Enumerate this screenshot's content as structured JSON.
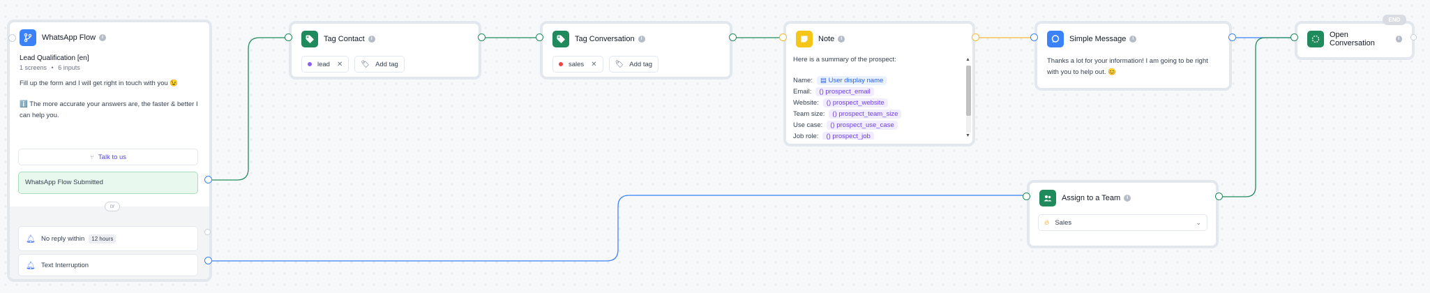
{
  "colors": {
    "green": "#1f8a5b",
    "blue": "#3b82f6",
    "yellow": "#f5c518",
    "submitted_bg": "#e9f8ef",
    "variable_purple": "#6d3fdf"
  },
  "whatsapp_flow": {
    "icon": "flow-branch-icon",
    "title": "WhatsApp Flow",
    "flow_name": "Lead Qualification [en]",
    "screens": "1 screens",
    "separator": "•",
    "inputs": "6 inputs",
    "text_line1": "Fill up the form and I will get right in touch with you 😉",
    "text_line2": "ℹ️ The more accurate your answers are, the faster & better I can help you.",
    "button_label": "Talk to us",
    "submitted_label": "WhatsApp Flow Submitted",
    "or_label": "or",
    "no_reply_label": "No reply within",
    "no_reply_value": "12 hours",
    "text_interruption_label": "Text Interruption"
  },
  "tag_contact": {
    "icon": "tag-icon",
    "title": "Tag Contact",
    "tag": "lead",
    "tag_color": "#8b5cf6",
    "add_label": "Add tag"
  },
  "tag_conversation": {
    "icon": "tag-icon",
    "title": "Tag Conversation",
    "tag": "sales",
    "tag_color": "#ef4444",
    "add_label": "Add tag"
  },
  "note": {
    "icon": "note-icon",
    "title": "Note",
    "intro": "Here is a summary of the prospect:",
    "fields": [
      {
        "label": "Name:",
        "value": "User display name",
        "kind": "contact"
      },
      {
        "label": "Email:",
        "value": "prospect_email",
        "kind": "variable"
      },
      {
        "label": "Website:",
        "value": "prospect_website",
        "kind": "variable"
      },
      {
        "label": "Team size:",
        "value": "prospect_team_size",
        "kind": "variable"
      },
      {
        "label": "Use case:",
        "value": "prospect_use_case",
        "kind": "variable"
      },
      {
        "label": "Job role:",
        "value": "prospect_job",
        "kind": "variable"
      }
    ]
  },
  "simple_message": {
    "icon": "chat-bubble-icon",
    "title": "Simple Message",
    "text": "Thanks a lot for your information! I am going to be right with you to help out. 😊"
  },
  "open_conversation": {
    "icon": "open-conversation-icon",
    "title": "Open Conversation",
    "end_label": "END"
  },
  "assign_team": {
    "icon": "team-icon",
    "title": "Assign to a Team",
    "selected_team": "Sales"
  }
}
